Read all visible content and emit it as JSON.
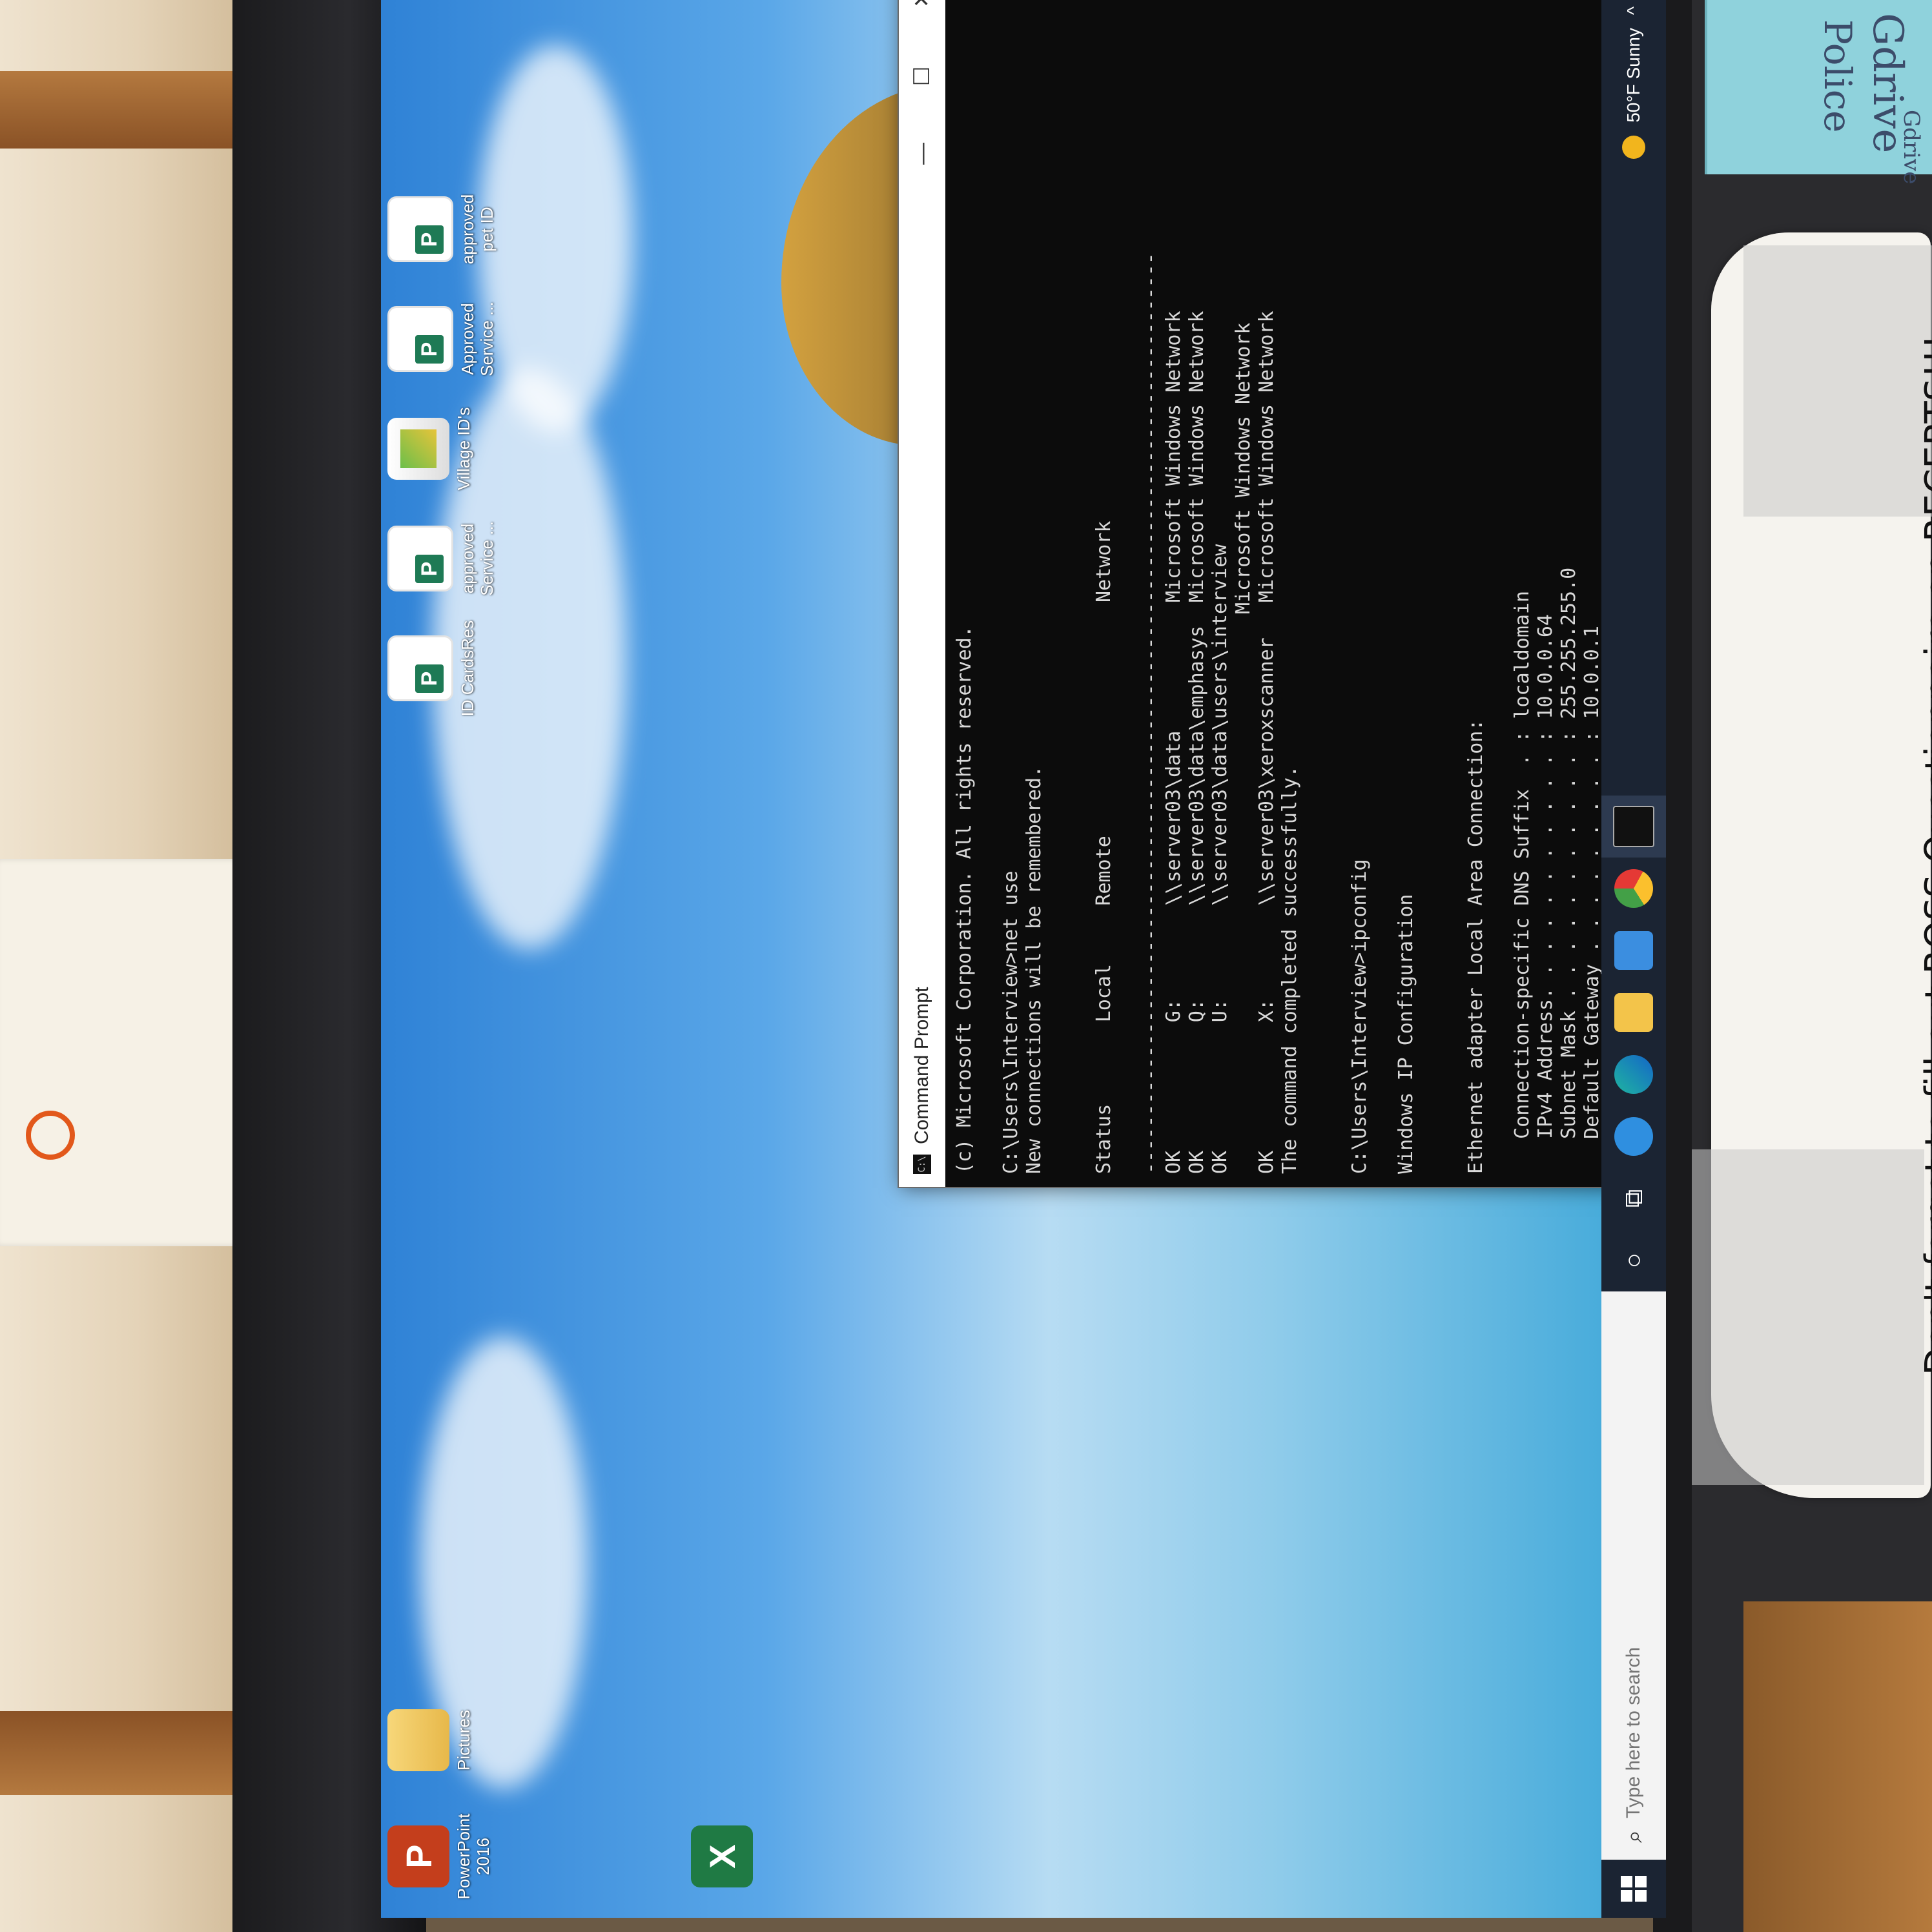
{
  "cmd": {
    "title": "Command Prompt",
    "lines": [
      "(c) Microsoft Corporation. All rights reserved.",
      "",
      "C:\\Users\\Interview>net use",
      "New connections will be remembered.",
      "",
      "",
      "Status       Local     Remote                    Network",
      "",
      "-------------------------------------------------------------------------------",
      "OK           G:        \\\\server03\\data           Microsoft Windows Network",
      "OK           Q:        \\\\server03\\data\\emphasys  Microsoft Windows Network",
      "OK           U:        \\\\server03\\data\\users\\interview",
      "                                                Microsoft Windows Network",
      "OK           X:        \\\\server03\\xeroxscanner   Microsoft Windows Network",
      "The command completed successfully.",
      "",
      "",
      "C:\\Users\\Interview>ipconfig",
      "",
      "Windows IP Configuration",
      "",
      "",
      "Ethernet adapter Local Area Connection:",
      "",
      "   Connection-specific DNS Suffix  . : localdomain",
      "   IPv4 Address. . . . . . . . . . . : 10.0.0.64",
      "   Subnet Mask . . . . . . . . . . . : 255.255.255.0",
      "   Default Gateway . . . . . . . . . : 10.0.0.1",
      "",
      "C:\\Users\\Interview>"
    ],
    "minimize": "—",
    "maximize": "☐",
    "close": "✕"
  },
  "desktop_icons": [
    {
      "label": "PowerPoint 2016",
      "kind": "ppt"
    },
    {
      "label": "Pictures",
      "kind": "folder"
    },
    {
      "label": "ID CardsRes",
      "kind": "pub"
    },
    {
      "label": "approved Service ...",
      "kind": "pub"
    },
    {
      "label": "Village ID's",
      "kind": "jpg"
    },
    {
      "label": "Approved Service ...",
      "kind": "pub"
    },
    {
      "label": "approved pet ID",
      "kind": "pub"
    }
  ],
  "taskbar": {
    "search_placeholder": "Type here to search",
    "weather": "50°F Sunny"
  },
  "sticky_note": {
    "line1": "Gdrive",
    "line2": "Police",
    "line3": "Gdrive"
  },
  "paper_note": "Don't forget to fill out ROSS Questionnaire on RECERTS!!!",
  "colors": {
    "console_bg": "#0c0c0c",
    "console_text": "#d9d9d9",
    "taskbar": "#1b2433"
  }
}
